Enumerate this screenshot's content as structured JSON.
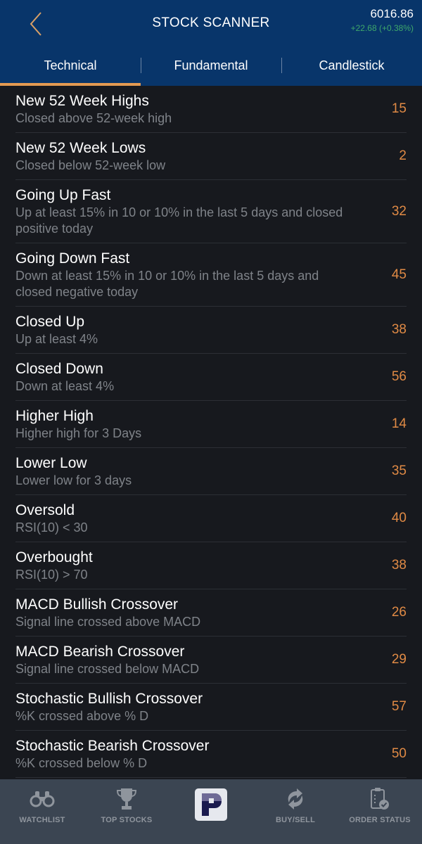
{
  "header": {
    "title": "STOCK SCANNER",
    "back_icon": "chevron-left-icon",
    "index_value": "6016.86",
    "index_change": "+22.68 (+0.38%)"
  },
  "tabs": [
    {
      "label": "Technical",
      "active": true
    },
    {
      "label": "Fundamental",
      "active": false
    },
    {
      "label": "Candlestick",
      "active": false
    }
  ],
  "scans": [
    {
      "title": "New 52 Week Highs",
      "description": "Closed above 52-week high",
      "count": "15"
    },
    {
      "title": "New 52 Week Lows",
      "description": "Closed below 52-week low",
      "count": "2"
    },
    {
      "title": "Going Up Fast",
      "description": "Up at least 15% in 10 or 10% in the last 5 days and closed positive today",
      "count": "32"
    },
    {
      "title": "Going Down Fast",
      "description": "Down at least 15% in 10 or 10% in the last 5 days and closed negative today",
      "count": "45"
    },
    {
      "title": "Closed Up",
      "description": "Up at least 4%",
      "count": "38"
    },
    {
      "title": "Closed Down",
      "description": "Down at least 4%",
      "count": "56"
    },
    {
      "title": "Higher High",
      "description": "Higher high for 3 Days",
      "count": "14"
    },
    {
      "title": "Lower Low",
      "description": "Lower low for 3 days",
      "count": "35"
    },
    {
      "title": "Oversold",
      "description": "RSI(10) < 30",
      "count": "40"
    },
    {
      "title": "Overbought",
      "description": "RSI(10) > 70",
      "count": "38"
    },
    {
      "title": "MACD Bullish Crossover",
      "description": "Signal line crossed above MACD",
      "count": "26"
    },
    {
      "title": "MACD Bearish Crossover",
      "description": "Signal line crossed below MACD",
      "count": "29"
    },
    {
      "title": "Stochastic Bullish Crossover",
      "description": "%K crossed above % D",
      "count": "57"
    },
    {
      "title": "Stochastic Bearish Crossover",
      "description": "%K crossed below % D",
      "count": "50"
    }
  ],
  "tabbar": [
    {
      "label": "WATCHLIST",
      "icon": "binoculars-icon"
    },
    {
      "label": "TOP STOCKS",
      "icon": "trophy-icon"
    },
    {
      "label": "",
      "icon": "app-logo-icon"
    },
    {
      "label": "BUY/SELL",
      "icon": "buy-sell-arrows-icon"
    },
    {
      "label": "ORDER STATUS",
      "icon": "clipboard-check-icon"
    }
  ],
  "colors": {
    "header_bg": "#08356a",
    "accent": "#e39a52",
    "count": "#e08a45",
    "positive": "#3ea86a",
    "list_bg": "#17191e",
    "tabbar_bg": "#3b4552"
  }
}
